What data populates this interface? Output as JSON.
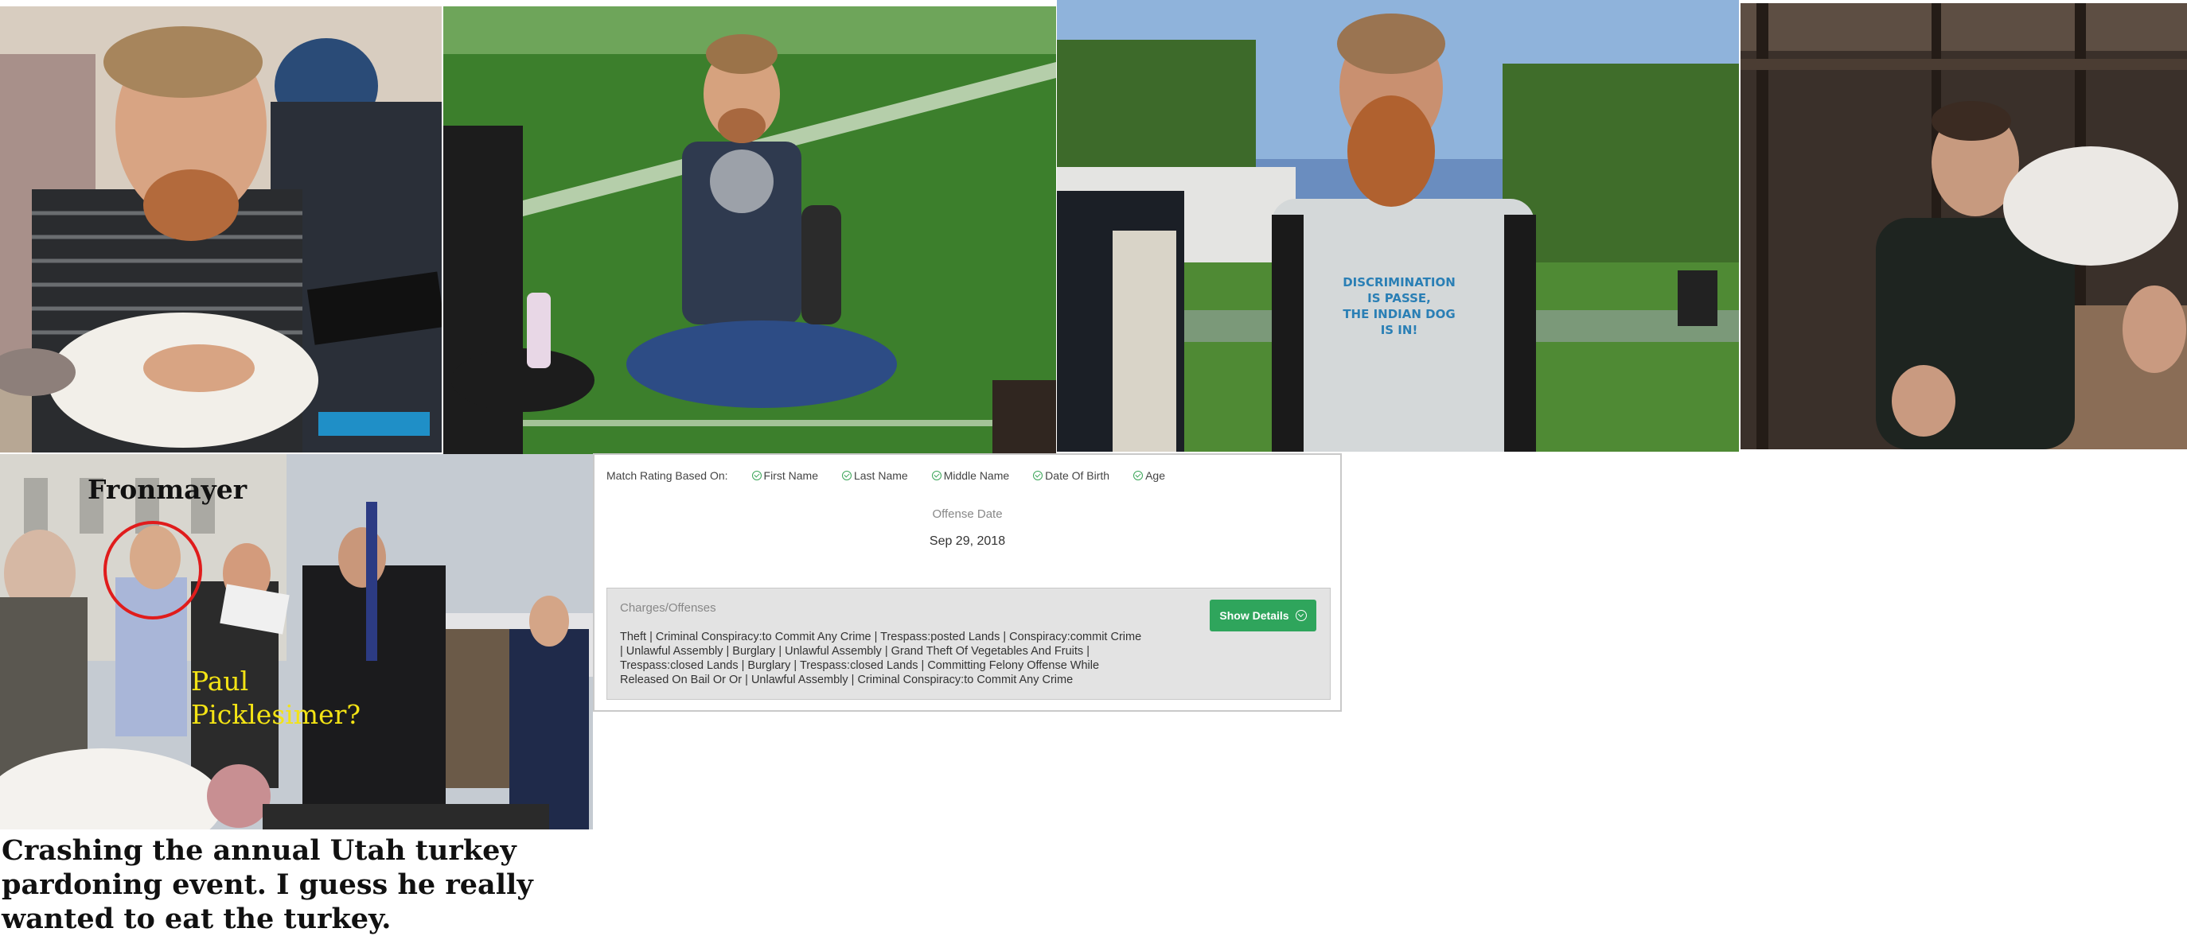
{
  "overlays": {
    "fronmayer_label": "Fronmayer",
    "paul_label_line1": "Paul",
    "paul_label_line2": "Picklesimer?"
  },
  "caption": "Crashing the annual Utah turkey pardoning event. I guess he really wanted to eat the turkey.",
  "photo3_shirt": {
    "line1": "DISCRIMINATION",
    "line2": "IS PASSE,",
    "line3": "THE INDIAN DOG",
    "line4": "IS IN!"
  },
  "record": {
    "match_lead": "Match Rating Based On:",
    "match_items": [
      "First Name",
      "Last Name",
      "Middle Name",
      "Date Of Birth",
      "Age"
    ],
    "offense_label": "Offense Date",
    "offense_date": "Sep 29, 2018",
    "charges_title": "Charges/Offenses",
    "charges_text": "Theft | Criminal Conspiracy:to Commit Any Crime | Trespass:posted Lands | Conspiracy:commit Crime | Unlawful Assembly | Burglary | Unlawful Assembly | Grand Theft Of Vegetables And Fruits | Trespass:closed Lands | Burglary | Trespass:closed Lands | Committing Felony Offense While Released On Bail Or Or | Unlawful Assembly | Criminal Conspiracy:to Commit Any Crime",
    "show_details_label": "Show Details"
  },
  "colors": {
    "accent_green": "#2fa55c",
    "circle_red": "#e01c1c",
    "paul_yellow": "#f3e315"
  }
}
